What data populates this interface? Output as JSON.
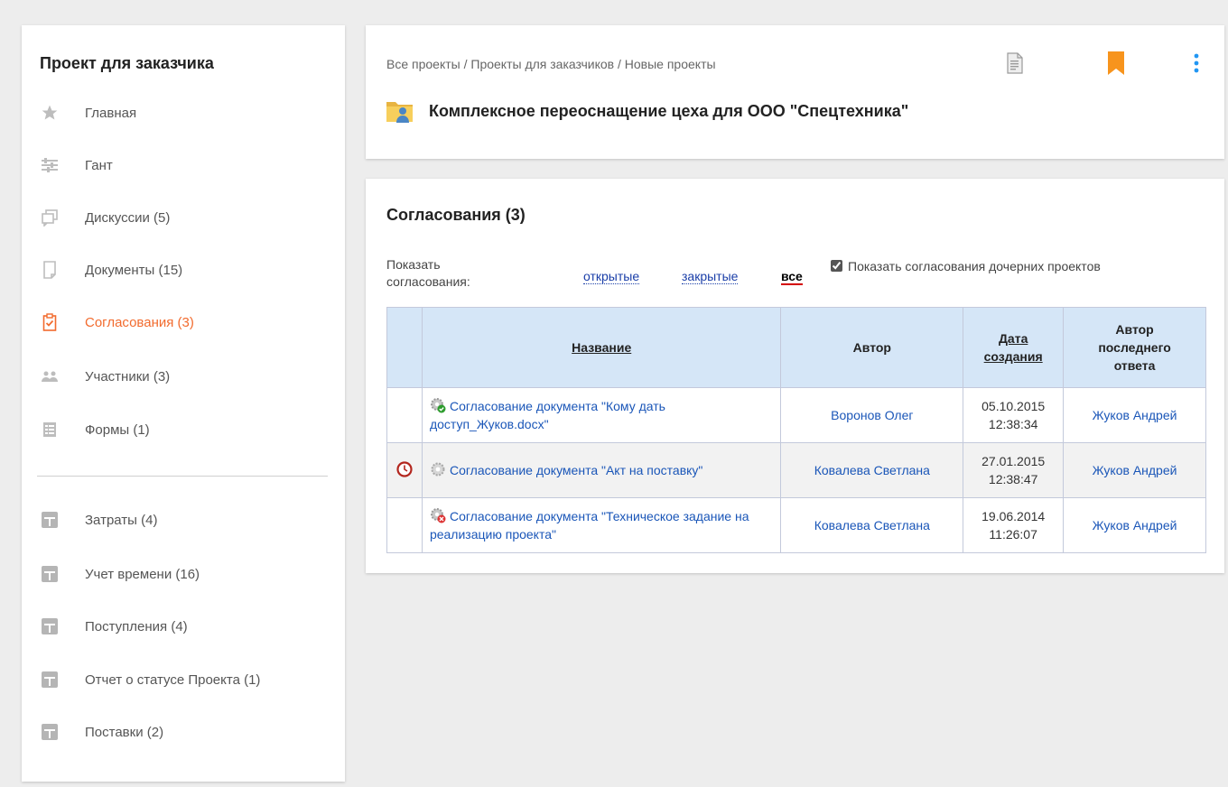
{
  "sidebar": {
    "title": "Проект для заказчика",
    "items": [
      {
        "label": "Главная",
        "icon": "star-icon"
      },
      {
        "label": "Гант",
        "icon": "gantt-icon"
      },
      {
        "label": "Дискуссии (5)",
        "icon": "discussions-icon"
      },
      {
        "label": "Документы (15)",
        "icon": "documents-icon"
      },
      {
        "label": "Согласования (3)",
        "icon": "approvals-icon",
        "active": true
      },
      {
        "label": "Участники (3)",
        "icon": "members-icon"
      },
      {
        "label": "Формы (1)",
        "icon": "forms-icon"
      }
    ],
    "extra_items": [
      {
        "label": "Затраты (4)",
        "icon": "table-icon"
      },
      {
        "label": "Учет времени (16)",
        "icon": "table-icon"
      },
      {
        "label": "Поступления (4)",
        "icon": "table-icon"
      },
      {
        "label": "Отчет о статусе Проекта (1)",
        "icon": "table-icon"
      },
      {
        "label": "Поставки (2)",
        "icon": "table-icon"
      }
    ]
  },
  "header": {
    "breadcrumb": [
      "Все проекты",
      "Проекты для заказчиков",
      "Новые проекты"
    ],
    "breadcrumb_sep": " / ",
    "project_title": "Комплексное переоснащение цеха для ООО \"Спецтехника\"",
    "actions": [
      "new-document-icon",
      "bookmark-icon",
      "more-vert-icon"
    ],
    "accent_color": "#f7941d"
  },
  "approvals": {
    "title": "Согласования (3)",
    "filter_label": "Показать согласования:",
    "filters": [
      {
        "label": "открытые",
        "current": false
      },
      {
        "label": "закрытые",
        "current": false
      },
      {
        "label": "все",
        "current": true
      }
    ],
    "child_checkbox": {
      "label": "Показать согласования дочерних проектов",
      "checked": true
    },
    "columns": {
      "name": "Название",
      "author": "Автор",
      "created_line1": "Дата",
      "created_line2": "создания",
      "last_author_line1": "Автор",
      "last_author_line2": "последнего",
      "last_author_line3": "ответа"
    },
    "rows": [
      {
        "row_icon": "",
        "status_icon": "approved-gear-icon",
        "name": "Согласование документа \"Кому дать доступ_Жуков.docx\"",
        "author": "Воронов Олег",
        "date": "05.10.2015",
        "time": "12:38:34",
        "last_author": "Жуков Андрей"
      },
      {
        "row_icon": "overdue-clock-icon",
        "status_icon": "in-progress-gear-icon",
        "name": "Согласование документа \"Акт на поставку\"",
        "author": "Ковалева Светлана",
        "date": "27.01.2015",
        "time": "12:38:47",
        "last_author": "Жуков Андрей"
      },
      {
        "row_icon": "",
        "status_icon": "rejected-gear-icon",
        "name": "Согласование документа \"Техническое задание на реализацию проекта\"",
        "author": "Ковалева Светлана",
        "date": "19.06.2014",
        "time": "11:26:07",
        "last_author": "Жуков Андрей"
      }
    ]
  }
}
